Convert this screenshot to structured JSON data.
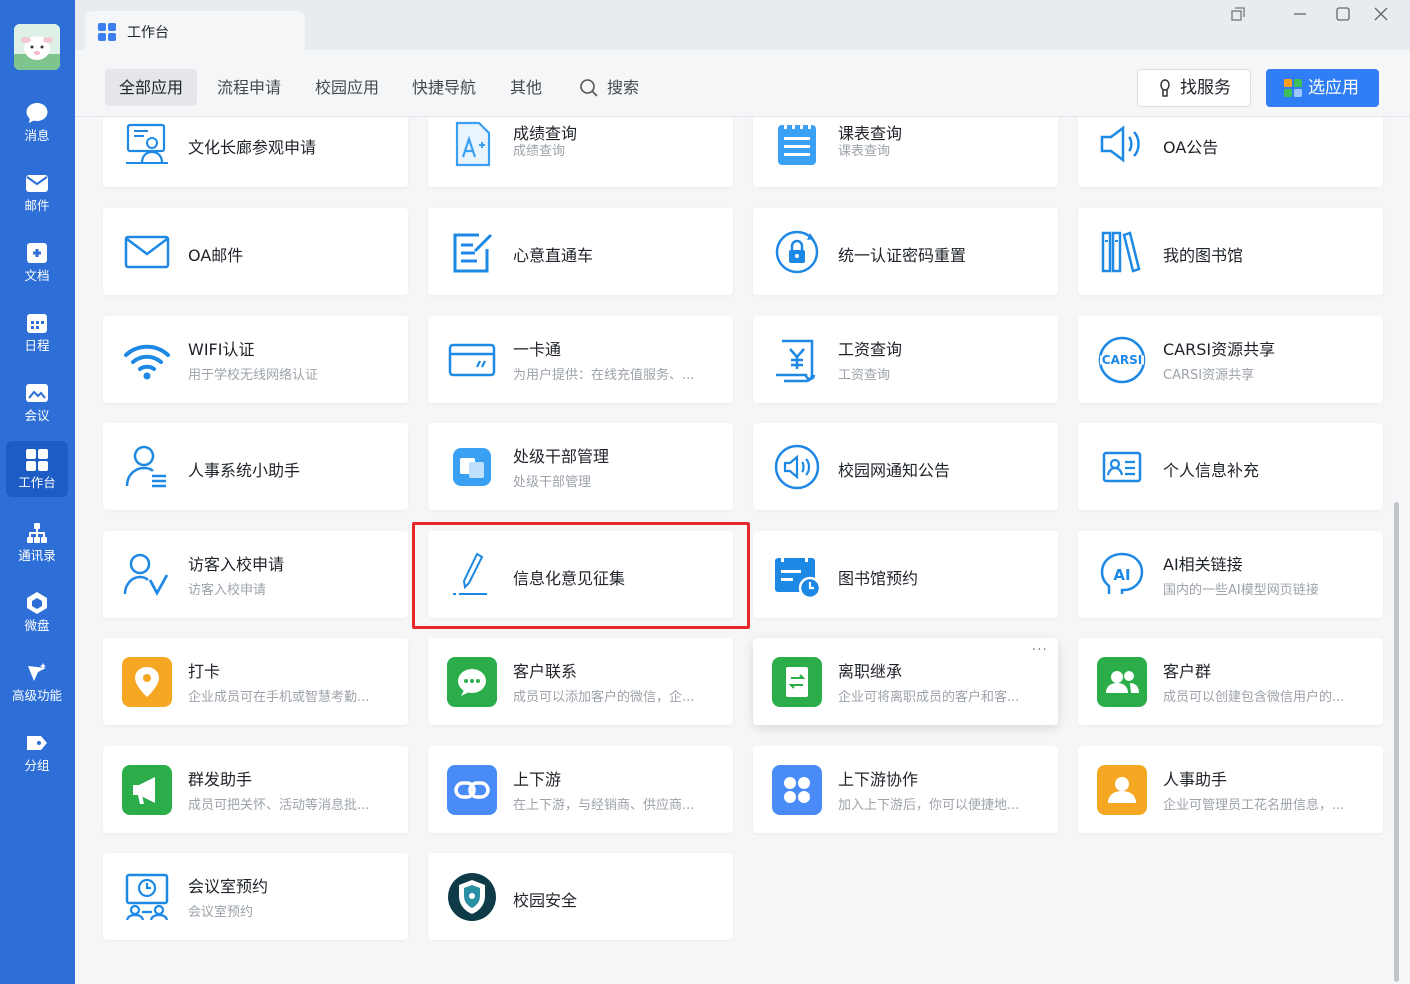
{
  "sidebar": {
    "items": [
      {
        "label": "消息",
        "icon": "chat-bubble-icon"
      },
      {
        "label": "邮件",
        "icon": "mail-icon"
      },
      {
        "label": "文档",
        "icon": "document-icon"
      },
      {
        "label": "日程",
        "icon": "calendar-icon"
      },
      {
        "label": "会议",
        "icon": "meeting-icon"
      },
      {
        "label": "工作台",
        "icon": "workbench-icon"
      },
      {
        "label": "通讯录",
        "icon": "contacts-icon"
      },
      {
        "label": "微盘",
        "icon": "cloud-disk-icon"
      },
      {
        "label": "高级功能",
        "icon": "advanced-icon"
      },
      {
        "label": "分组",
        "icon": "tag-icon"
      }
    ]
  },
  "window": {
    "tab_title": "工作台"
  },
  "nav": {
    "tabs": [
      "全部应用",
      "流程申请",
      "校园应用",
      "快捷导航",
      "其他"
    ],
    "search_label": "搜索",
    "find_service": "找服务",
    "select_app": "选应用"
  },
  "apps": [
    {
      "title": "文化长廊参观申请",
      "desc": ""
    },
    {
      "title": "成绩查询",
      "desc": "成绩查询"
    },
    {
      "title": "课表查询",
      "desc": "课表查询"
    },
    {
      "title": "OA公告",
      "desc": ""
    },
    {
      "title": "OA邮件",
      "desc": ""
    },
    {
      "title": "心意直通车",
      "desc": ""
    },
    {
      "title": "统一认证密码重置",
      "desc": ""
    },
    {
      "title": "我的图书馆",
      "desc": ""
    },
    {
      "title": "WIFI认证",
      "desc": "用于学校无线网络认证"
    },
    {
      "title": "一卡通",
      "desc": "为用户提供：在线充值服务、..."
    },
    {
      "title": "工资查询",
      "desc": "工资查询"
    },
    {
      "title": "CARSI资源共享",
      "desc": "CARSI资源共享"
    },
    {
      "title": "人事系统小助手",
      "desc": ""
    },
    {
      "title": "处级干部管理",
      "desc": "处级干部管理"
    },
    {
      "title": "校园网通知公告",
      "desc": ""
    },
    {
      "title": "个人信息补充",
      "desc": ""
    },
    {
      "title": "访客入校申请",
      "desc": "访客入校申请"
    },
    {
      "title": "信息化意见征集",
      "desc": ""
    },
    {
      "title": "图书馆预约",
      "desc": ""
    },
    {
      "title": "AI相关链接",
      "desc": "国内的一些AI模型网页链接"
    },
    {
      "title": "打卡",
      "desc": "企业成员可在手机或智慧考勤..."
    },
    {
      "title": "客户联系",
      "desc": "成员可以添加客户的微信，企..."
    },
    {
      "title": "离职继承",
      "desc": "企业可将离职成员的客户和客..."
    },
    {
      "title": "客户群",
      "desc": "成员可以创建包含微信用户的..."
    },
    {
      "title": "群发助手",
      "desc": "成员可把关怀、活动等消息批..."
    },
    {
      "title": "上下游",
      "desc": "在上下游，与经销商、供应商..."
    },
    {
      "title": "上下游协作",
      "desc": "加入上下游后，你可以便捷地..."
    },
    {
      "title": "人事助手",
      "desc": "企业可管理员工花名册信息，..."
    },
    {
      "title": "会议室预约",
      "desc": "会议室预约"
    },
    {
      "title": "校园安全",
      "desc": ""
    }
  ],
  "colors": {
    "sidebar": "#2d6fd6",
    "primary": "#2f7ef5",
    "highlight": "#e8262b",
    "wework_green": "#2bad4a",
    "wework_orange": "#f5a623"
  }
}
